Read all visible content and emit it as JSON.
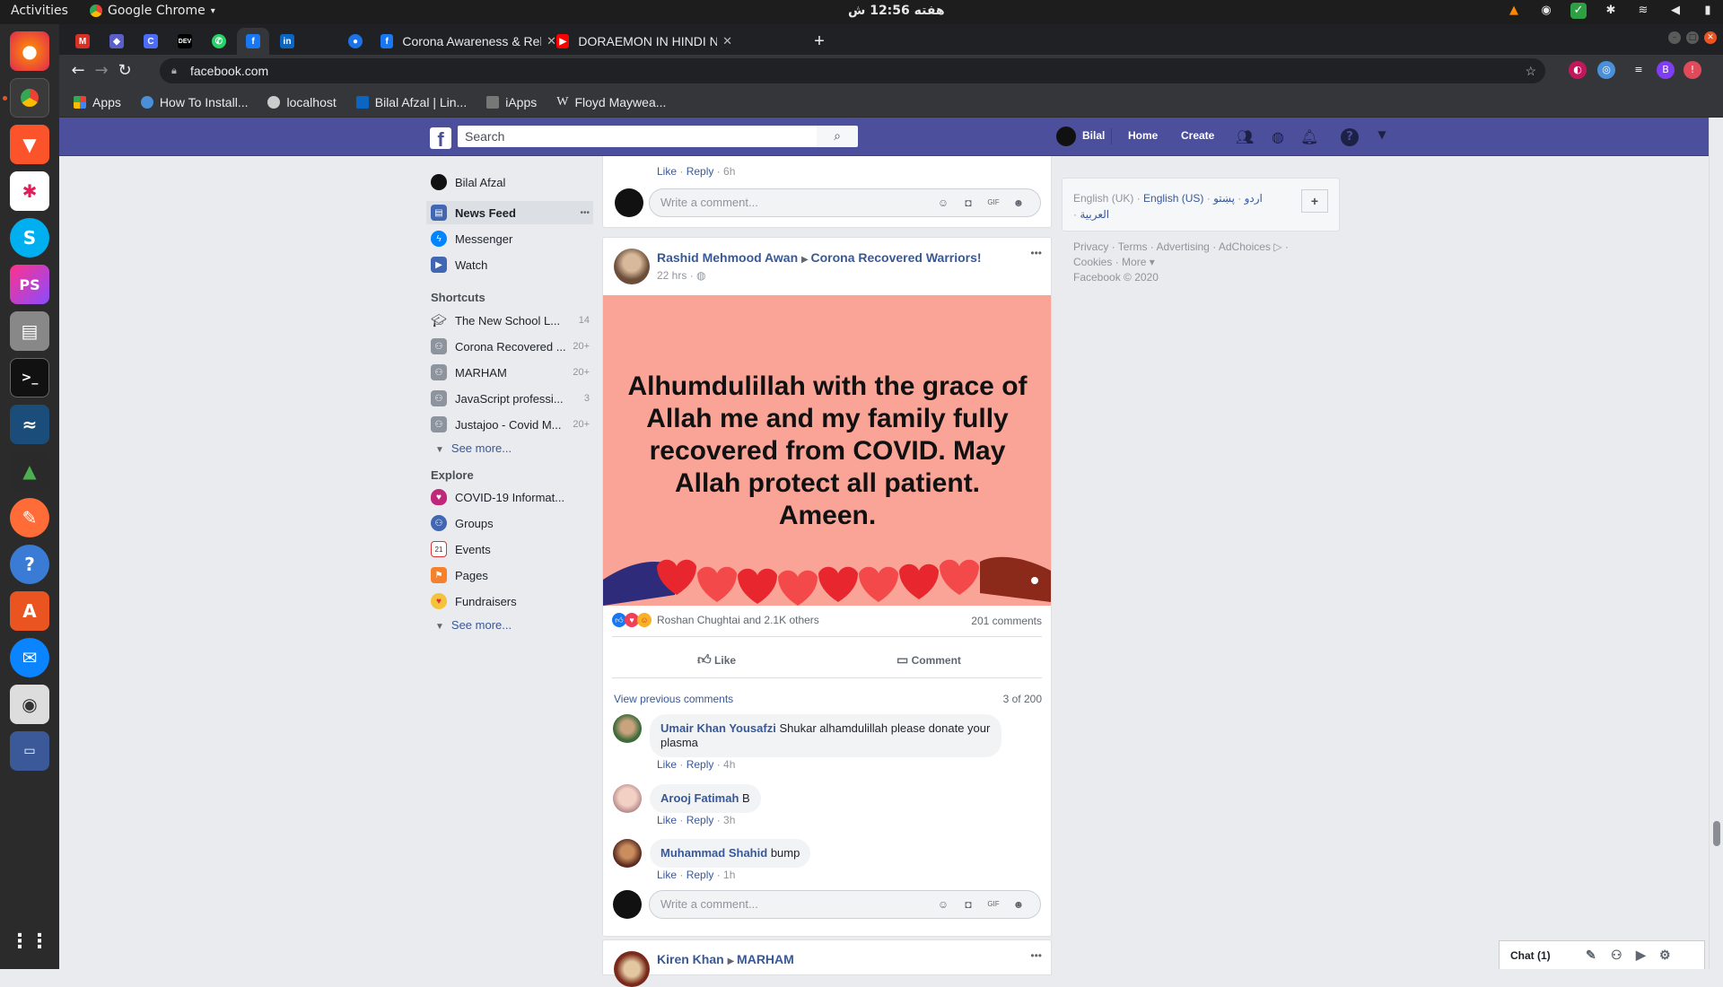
{
  "system": {
    "activities": "Activities",
    "app_name": "Google Chrome",
    "clock": "هفته 12:56 ش"
  },
  "tabs": [
    {
      "title": "Corona Awareness & Relie",
      "close": "✕"
    },
    {
      "title": "DORAEMON IN HINDI NE",
      "close": "✕"
    }
  ],
  "new_tab": "+",
  "address": "facebook.com",
  "bookmarks": [
    "Apps",
    "How To Install...",
    "localhost",
    "Bilal Afzal | Lin...",
    "iApps",
    "Floyd Maywea..."
  ],
  "fb": {
    "search_placeholder": "Search",
    "user": "Bilal",
    "home": "Home",
    "create": "Create"
  },
  "leftnav": {
    "profile": "Bilal Afzal",
    "main": [
      {
        "label": "News Feed",
        "more": "•••"
      },
      {
        "label": "Messenger"
      },
      {
        "label": "Watch"
      }
    ],
    "shortcuts_header": "Shortcuts",
    "shortcuts": [
      {
        "label": "The New School L...",
        "count": "14"
      },
      {
        "label": "Corona Recovered ...",
        "count": "20+"
      },
      {
        "label": "MARHAM",
        "count": "20+"
      },
      {
        "label": "JavaScript professi...",
        "count": "3"
      },
      {
        "label": "Justajoo - Covid M...",
        "count": "20+"
      }
    ],
    "see_more": "See more...",
    "explore_header": "Explore",
    "explore": [
      {
        "label": "COVID-19 Informat..."
      },
      {
        "label": "Groups"
      },
      {
        "label": "Events",
        "icon_text": "21"
      },
      {
        "label": "Pages"
      },
      {
        "label": "Fundraisers"
      }
    ]
  },
  "top_comment": {
    "like": "Like",
    "reply": "Reply",
    "time": "6h",
    "placeholder": "Write a comment..."
  },
  "post": {
    "author": "Rashid Mehmood Awan",
    "group": "Corona Recovered Warriors!",
    "time": "22 hrs",
    "menu": "•••",
    "text": "Alhumdulillah with the grace of Allah me and my family fully recovered from COVID. May Allah protect all patient. Ameen.",
    "bg_color": "#f9a497",
    "reactions": "Roshan Chughtai and 2.1K others",
    "comments_count": "201 comments",
    "like_btn": "Like",
    "comment_btn": "Comment",
    "view_previous": "View previous comments",
    "pager": "3 of 200",
    "comments": [
      {
        "author": "Umair Khan Yousafzi",
        "text": "Shukar alhamdulillah please donate your plasma",
        "like": "Like",
        "reply": "Reply",
        "time": "4h"
      },
      {
        "author": "Arooj Fatimah",
        "text": "B",
        "like": "Like",
        "reply": "Reply",
        "time": "3h"
      },
      {
        "author": "Muhammad Shahid",
        "text": "bump",
        "like": "Like",
        "reply": "Reply",
        "time": "1h"
      }
    ],
    "comment_placeholder": "Write a comment..."
  },
  "next_post": {
    "author": "Kiren Khan",
    "group": "MARHAM",
    "menu": "•••"
  },
  "right": {
    "lang_current": "English (UK)",
    "lang_other": "English (US)",
    "lang_urdu": "اردو",
    "lang_pashto": "پښتو",
    "lang_arabic": "العربية",
    "plus": "+",
    "footer_links": [
      "Privacy",
      "Terms",
      "Advertising",
      "AdChoices",
      "Cookies",
      "More"
    ],
    "copyright": "Facebook © 2020"
  },
  "chat": {
    "label": "Chat (1)"
  }
}
